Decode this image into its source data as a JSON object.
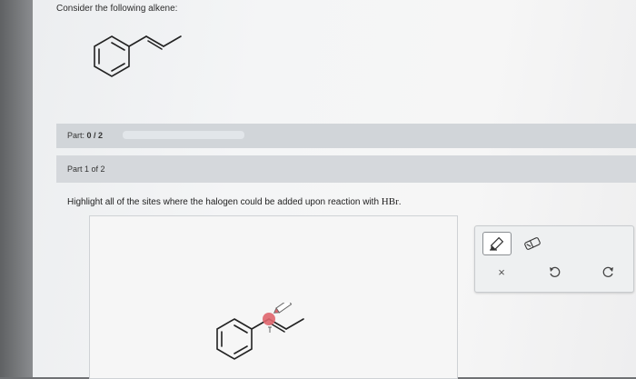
{
  "intro": "Consider the following alkene:",
  "part": {
    "label": "Part:",
    "score": "0 / 2",
    "progress": 0
  },
  "subpart": {
    "label": "Part 1 of 2"
  },
  "question": {
    "text": "Highlight all of the sites where the halogen could be added upon reaction with ",
    "reagent": "HBr",
    "end": "."
  },
  "toolbox": {
    "clear_label": "×",
    "tools": [
      "highlighter-icon",
      "eraser-icon",
      "close-icon",
      "undo-icon",
      "redo-icon"
    ]
  },
  "colors": {
    "highlight": "#e0666e",
    "bar": "#d1d5d9",
    "page": "#f4f5f6"
  }
}
